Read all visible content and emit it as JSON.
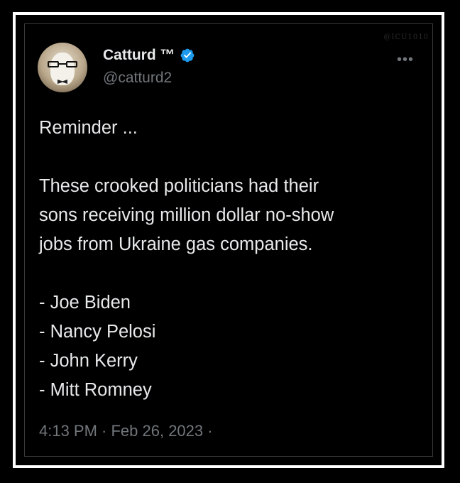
{
  "watermark": "@ICU1010",
  "tweet": {
    "author": {
      "display_name": "Catturd ™",
      "handle": "@catturd2",
      "verified": true,
      "avatar": "cat-with-glasses-avatar"
    },
    "more_icon": "ellipsis-icon",
    "body_lines": [
      "Reminder ...",
      "",
      "These crooked politicians had their",
      "sons receiving million dollar no-show",
      "jobs from Ukraine gas companies.",
      "",
      "- Joe Biden",
      "- Nancy Pelosi",
      "- John Kerry",
      "- Mitt Romney"
    ],
    "timestamp": "4:13 PM · Feb 26, 2023 ·"
  },
  "colors": {
    "background": "#000000",
    "frame": "#ffffff",
    "primary_text": "#e7e9ea",
    "secondary_text": "#71767b",
    "verified_badge": "#1d9bf0"
  }
}
